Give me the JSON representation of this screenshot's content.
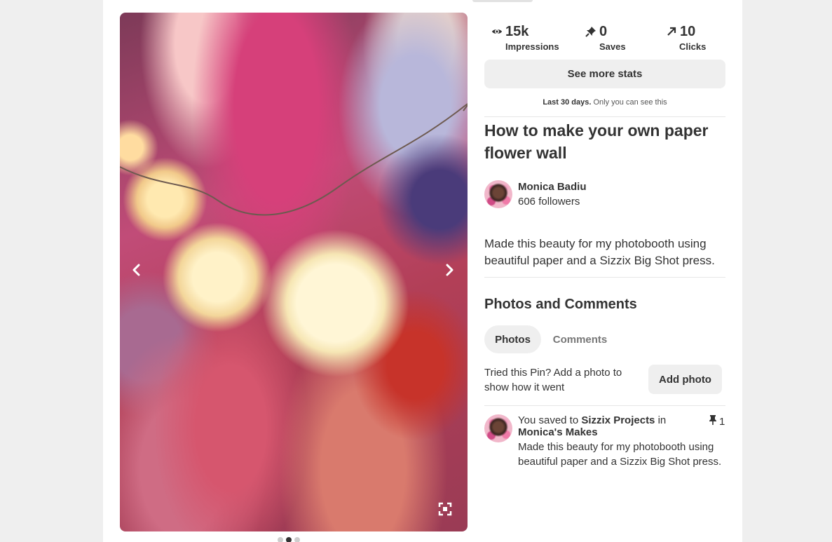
{
  "stats": {
    "impressions": {
      "value": "15k",
      "label": "Impressions",
      "icon": "eye-icon"
    },
    "saves": {
      "value": "0",
      "label": "Saves",
      "icon": "pin-icon"
    },
    "clicks": {
      "value": "10",
      "label": "Clicks",
      "icon": "arrow-up-right-icon"
    },
    "see_more_label": "See more stats",
    "note_bold": "Last 30 days.",
    "note_rest": "Only you can see this"
  },
  "pin": {
    "title": "How to make your own paper flower wall",
    "description": "Made this beauty for my photobooth using beautiful paper and a Sizzix Big Shot press."
  },
  "author": {
    "name": "Monica Badiu",
    "followers": "606 followers"
  },
  "photos_comments": {
    "title": "Photos and Comments",
    "tabs": [
      {
        "label": "Photos",
        "selected": true
      },
      {
        "label": "Comments",
        "selected": false
      }
    ],
    "tried_text": "Tried this Pin? Add a photo to show how it went",
    "add_photo_label": "Add photo"
  },
  "activity": {
    "prefix": "You saved to",
    "board": "Sizzix Projects",
    "in_word": "in",
    "section": "Monica's Makes",
    "description": "Made this beauty for my photobooth using beautiful paper and a Sizzix Big Shot press.",
    "save_count": "1"
  },
  "carousel": {
    "prev_icon": "chevron-left-icon",
    "next_icon": "chevron-right-icon",
    "expand_icon": "expand-icon",
    "total_images": 3,
    "active_index": 1
  },
  "colors": {
    "text": "#333333",
    "button_bg": "#efefef",
    "muted": "#777777"
  }
}
